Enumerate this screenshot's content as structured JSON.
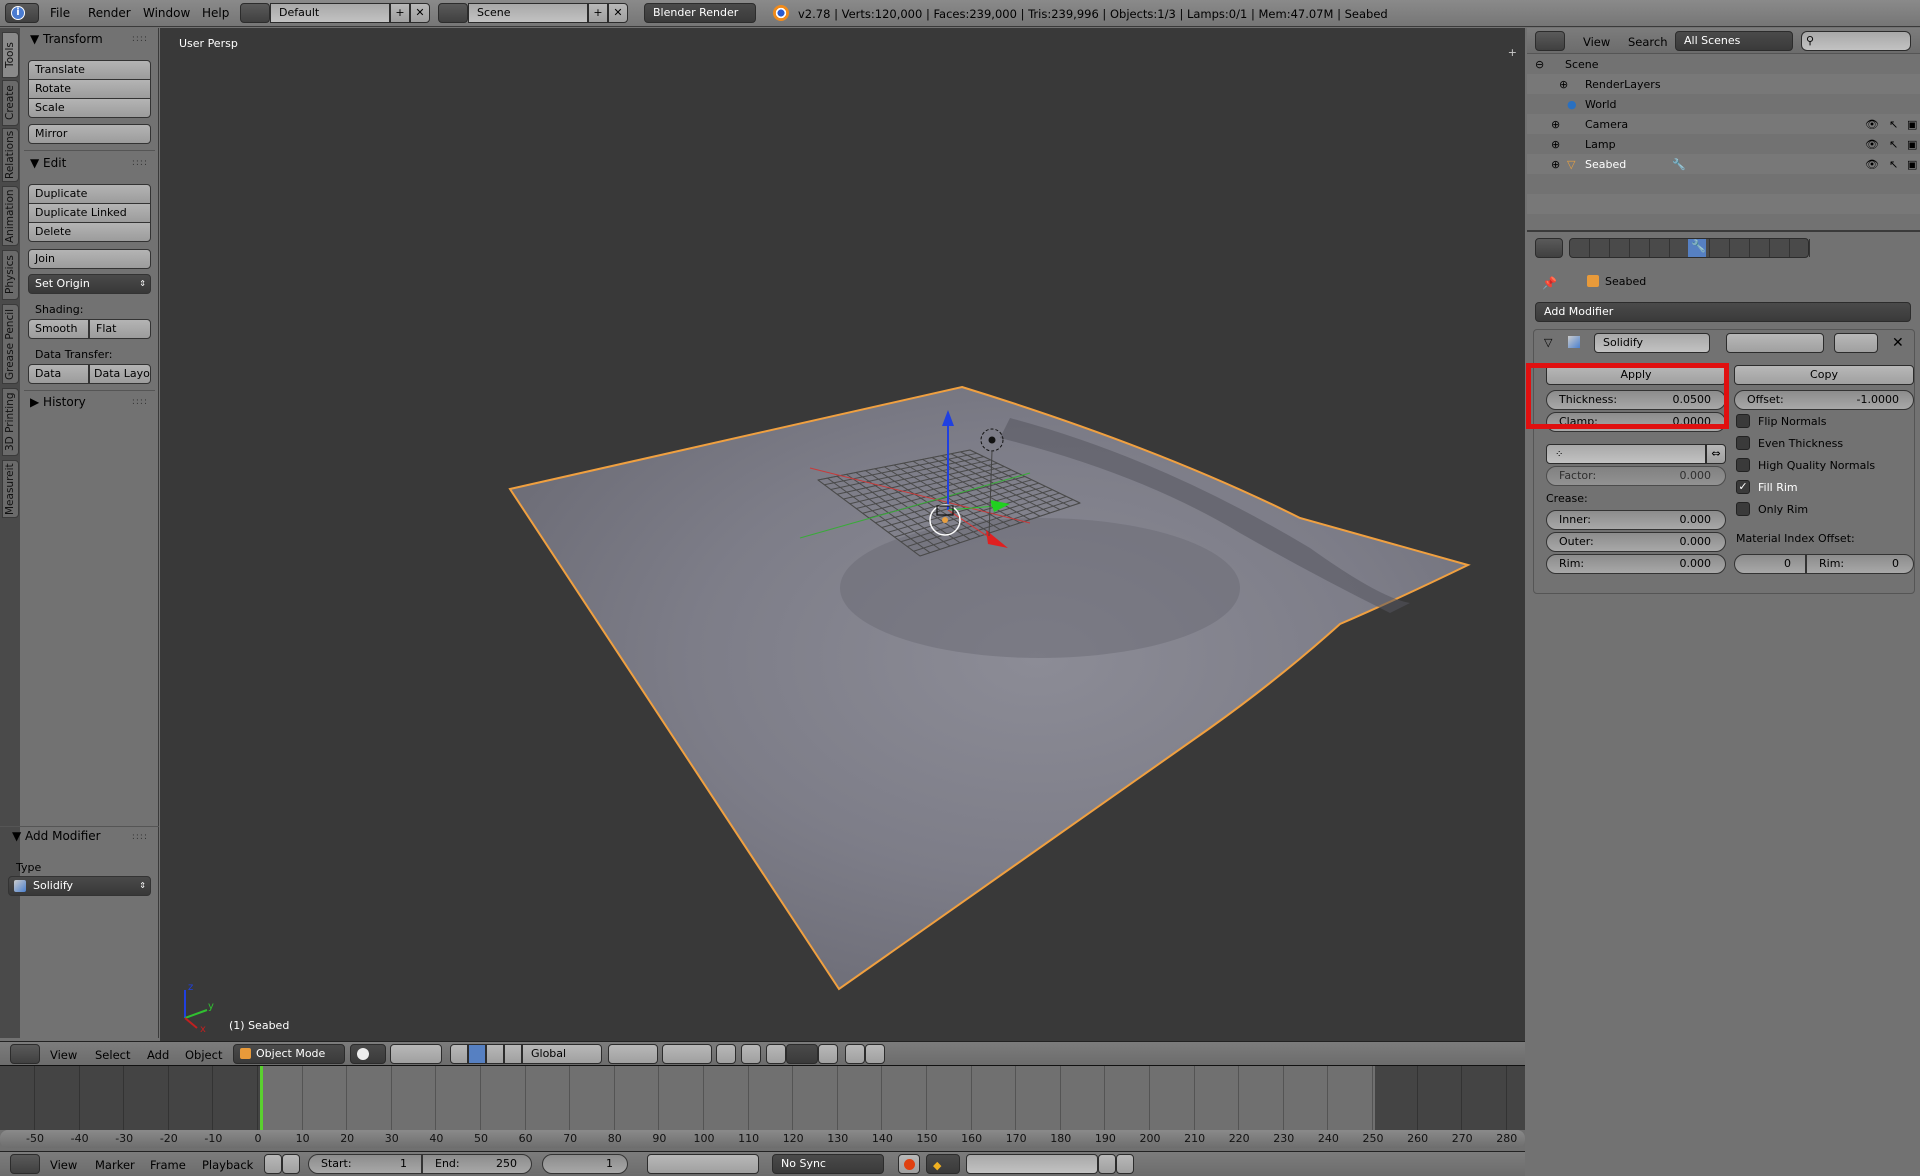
{
  "topbar": {
    "menus": [
      "File",
      "Render",
      "Window",
      "Help"
    ],
    "screen_layout": "Default",
    "scene": "Scene",
    "render_engine": "Blender Render",
    "stats": "v2.78 | Verts:120,000 | Faces:239,000 | Tris:239,996 | Objects:1/3 | Lamps:0/1 | Mem:47.07M | Seabed"
  },
  "tool_tabs": [
    "Tools",
    "Create",
    "Relations",
    "Animation",
    "Physics",
    "Grease Pencil",
    "3D Printing",
    "Measureit"
  ],
  "tools": {
    "transform_header": "Transform",
    "translate": "Translate",
    "rotate": "Rotate",
    "scale": "Scale",
    "mirror": "Mirror",
    "edit_header": "Edit",
    "duplicate": "Duplicate",
    "duplicate_linked": "Duplicate Linked",
    "delete": "Delete",
    "join": "Join",
    "set_origin": "Set Origin",
    "shading_label": "Shading:",
    "smooth": "Smooth",
    "flat": "Flat",
    "data_transfer_label": "Data Transfer:",
    "data": "Data",
    "data_layout": "Data Layo",
    "history_header": "History"
  },
  "operator_panel": {
    "header": "Add Modifier",
    "type_label": "Type",
    "type_value": "Solidify"
  },
  "viewport": {
    "view_label": "User Persp",
    "object_label": "(1) Seabed",
    "axis_labels": {
      "x": "x",
      "y": "y",
      "z": "z"
    }
  },
  "view3d_header": {
    "menus": [
      "View",
      "Select",
      "Add",
      "Object"
    ],
    "mode": "Object Mode",
    "orientation": "Global"
  },
  "timeline": {
    "ticks": [
      -50,
      -40,
      -30,
      -20,
      -10,
      0,
      10,
      20,
      30,
      40,
      50,
      60,
      70,
      80,
      90,
      100,
      110,
      120,
      130,
      140,
      150,
      160,
      170,
      180,
      190,
      200,
      210,
      220,
      230,
      240,
      250,
      260,
      270,
      280
    ],
    "current_frame": 1,
    "menus": [
      "View",
      "Marker",
      "Frame",
      "Playback"
    ],
    "start_label": "Start:",
    "start": "1",
    "end_label": "End:",
    "end": "250",
    "frame": "1",
    "sync": "No Sync"
  },
  "outliner": {
    "menus": [
      "View",
      "Search"
    ],
    "filter": "All Scenes",
    "search_placeholder": "",
    "items": [
      {
        "name": "Scene",
        "level": 0
      },
      {
        "name": "RenderLayers",
        "level": 1
      },
      {
        "name": "World",
        "level": 1
      },
      {
        "name": "Camera",
        "level": 1
      },
      {
        "name": "Lamp",
        "level": 1
      },
      {
        "name": "Seabed",
        "level": 1
      }
    ]
  },
  "properties": {
    "breadcrumb_object": "Seabed",
    "add_modifier": "Add Modifier",
    "modifier_name": "Solidify",
    "apply": "Apply",
    "copy": "Copy",
    "thickness_label": "Thickness:",
    "thickness": "0.0500",
    "clamp_label": "Clamp:",
    "clamp": "0.0000",
    "offset_label": "Offset:",
    "offset": "-1.0000",
    "factor_label": "Factor:",
    "factor": "0.000",
    "crease_label": "Crease:",
    "inner_label": "Inner:",
    "inner": "0.000",
    "outer_label": "Outer:",
    "outer": "0.000",
    "rim_label": "Rim:",
    "rim": "0.000",
    "checkboxes": [
      {
        "label": "Flip Normals",
        "checked": false
      },
      {
        "label": "Even Thickness",
        "checked": false
      },
      {
        "label": "High Quality Normals",
        "checked": false
      },
      {
        "label": "Fill Rim",
        "checked": true
      },
      {
        "label": "Only Rim",
        "checked": false
      }
    ],
    "material_index_label": "Material Index Offset:",
    "material_index": "0",
    "material_rim_label": "Rim:",
    "material_rim": "0"
  },
  "colors": {
    "highlight": "#e01010",
    "selection_outline": "#f0a040",
    "active_tab": "#5680c2",
    "current_frame": "#5ad12f"
  }
}
